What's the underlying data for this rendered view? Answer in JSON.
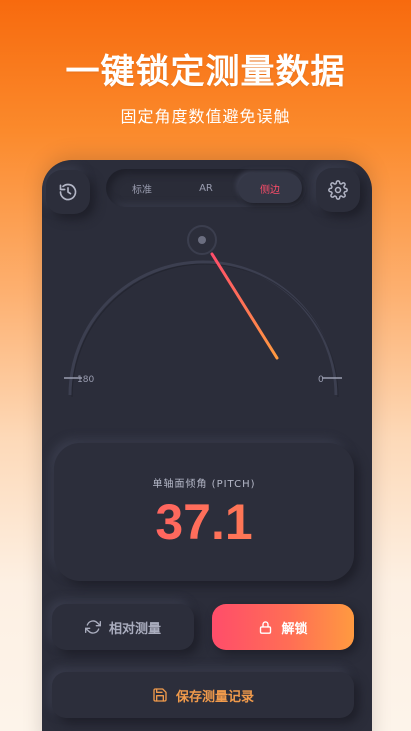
{
  "promo": {
    "headline": "一键锁定测量数据",
    "subline": "固定角度数值避免误触"
  },
  "toolbar": {
    "history_icon": "history-icon",
    "settings_icon": "gear-icon",
    "modes": [
      {
        "label": "标准",
        "active": false
      },
      {
        "label": "AR",
        "active": false
      },
      {
        "label": "侧边",
        "active": true
      }
    ]
  },
  "gauge": {
    "left_label": "180",
    "right_label": "0",
    "angle": 37.1
  },
  "reading": {
    "label": "单轴面倾角 (PITCH)",
    "value": "37.1"
  },
  "actions": {
    "relative_label": "相对测量",
    "unlock_label": "解锁",
    "save_label": "保存测量记录"
  },
  "colors": {
    "accent_start": "#ff4d6a",
    "accent_end": "#ff9a40",
    "panel": "#2b2d3a"
  }
}
